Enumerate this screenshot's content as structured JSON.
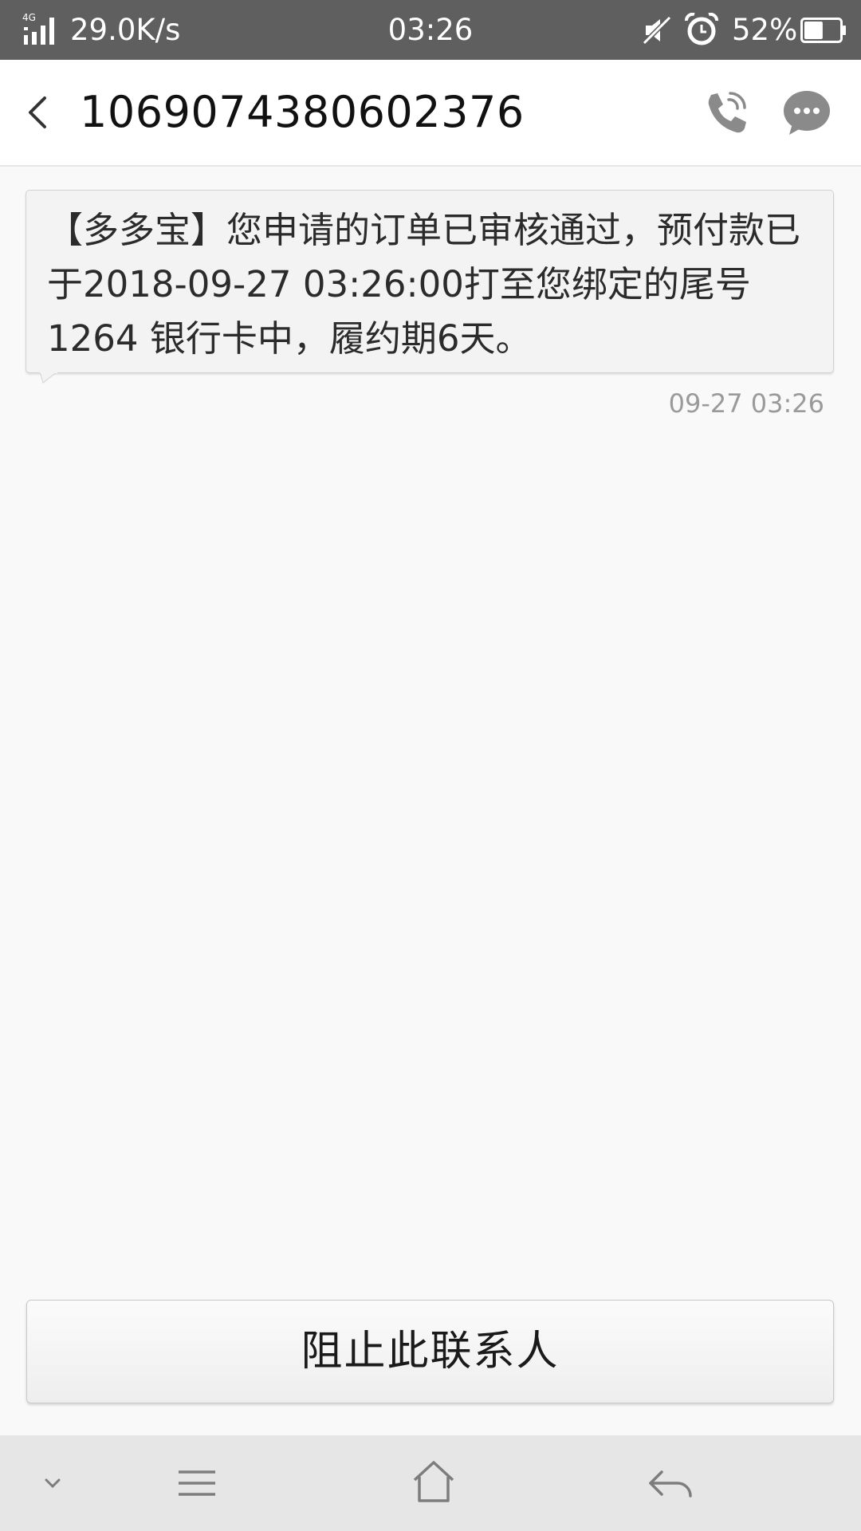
{
  "status_bar": {
    "network_type": "4G",
    "net_speed": "29.0K/s",
    "time": "03:26",
    "battery_percent": "52%",
    "battery_level": 0.52,
    "icons": [
      "signal-icon",
      "mute-icon",
      "alarm-icon",
      "battery-icon"
    ]
  },
  "header": {
    "title": "1069074380602376",
    "icons": [
      "back-arrow-icon",
      "phone-call-icon",
      "message-icon"
    ]
  },
  "conversation": {
    "messages": [
      {
        "text": "【多多宝】您申请的订单已审核通过，预付款已于2018-09-27 03:26:00打至您绑定的尾号1264 银行卡中，履约期6天。",
        "time": "09-27 03:26"
      }
    ]
  },
  "block_button": {
    "label": "阻止此联系人"
  },
  "nav_bar": {
    "icons": [
      "chevron-down-icon",
      "menu-icon",
      "home-icon",
      "back-icon"
    ]
  },
  "colors": {
    "status_bar_bg": "#5f5f5f",
    "page_bg": "#f9f9f9",
    "icon_gray": "#7d7d7d",
    "nav_bar_bg": "#e6e6e6"
  }
}
